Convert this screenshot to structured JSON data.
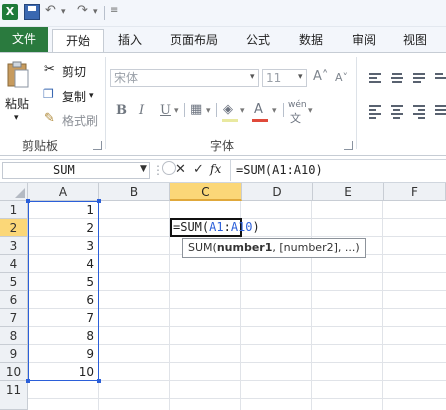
{
  "qat": {
    "logo": "X"
  },
  "tabs": [
    "文件",
    "开始",
    "插入",
    "页面布局",
    "公式",
    "数据",
    "审阅",
    "视图"
  ],
  "clipboard": {
    "paste": "粘贴",
    "cut": "剪切",
    "copy": "复制",
    "format_painter": "格式刷",
    "group": "剪贴板"
  },
  "font": {
    "name": "宋体",
    "size": "11",
    "bold": "B",
    "italic": "I",
    "underline": "U",
    "wen": "wén",
    "group": "字体"
  },
  "formula_bar": {
    "name_box": "SUM",
    "fx": "fx",
    "formula": "=SUM(A1:A10)"
  },
  "columns": [
    "A",
    "B",
    "C",
    "D",
    "E",
    "F"
  ],
  "rows": [
    "1",
    "2",
    "3",
    "4",
    "5",
    "6",
    "7",
    "8",
    "9",
    "10",
    "11"
  ],
  "a_values": [
    "1",
    "2",
    "3",
    "4",
    "5",
    "6",
    "7",
    "8",
    "9",
    "10"
  ],
  "edit_cell": {
    "prefix": "=SUM(",
    "ref_a": "A1",
    "colon": ":",
    "ref_b": "A10",
    "suffix": ")"
  },
  "tooltip": {
    "fn": "SUM(",
    "arg1": "number1",
    "rest": ", [number2], ...)"
  }
}
